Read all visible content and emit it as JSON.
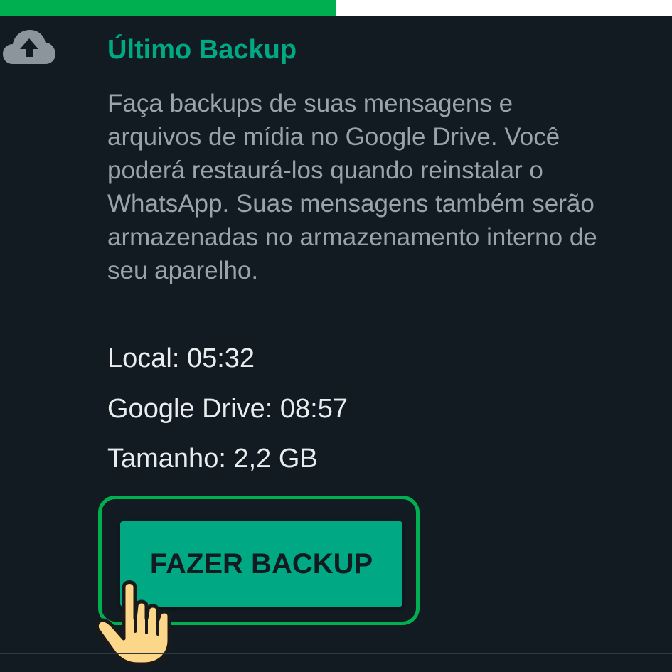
{
  "progress": {
    "fraction": 0.5,
    "fill_color": "#00b050"
  },
  "section": {
    "icon": "cloud-upload-icon",
    "title": "Último Backup",
    "description_lines": [
      "Faça backups de suas mensagens e",
      "arquivos de mídia no Google Drive. Você",
      "poderá restaurá-los quando reinstalar o",
      "WhatsApp. Suas mensagens também serão",
      "armazenadas no armazenamento interno de",
      "seu aparelho."
    ],
    "local": "Local: 05:32",
    "google_drive": "Google Drive: 08:57",
    "size": "Tamanho: 2,2 GB"
  },
  "button": {
    "label": "FAZER BACKUP"
  },
  "annotation": {
    "pointer_icon": "pointing-hand-icon",
    "highlight_color": "#00b050"
  },
  "colors": {
    "background": "#111b21",
    "accent": "#00a884",
    "text_primary": "#e9edef",
    "text_secondary": "#9aa3a9"
  }
}
